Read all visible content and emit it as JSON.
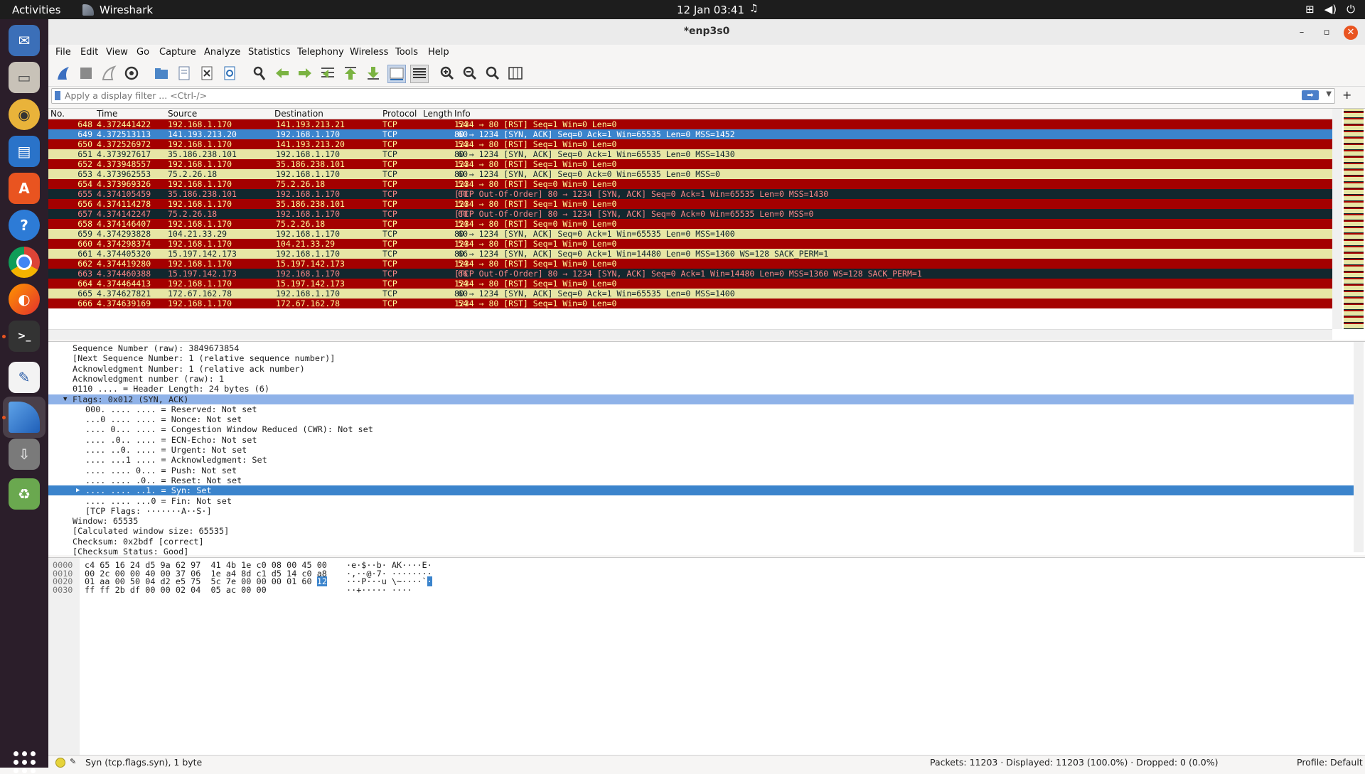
{
  "topbar": {
    "activities": "Activities",
    "app": "Wireshark",
    "clock": "12 Jan  03:41"
  },
  "window": {
    "title": "*enp3s0"
  },
  "menu": [
    "File",
    "Edit",
    "View",
    "Go",
    "Capture",
    "Analyze",
    "Statistics",
    "Telephony",
    "Wireless",
    "Tools",
    "Help"
  ],
  "filter": {
    "placeholder": "Apply a display filter ... <Ctrl-/>"
  },
  "columns": {
    "no": "No.",
    "time": "Time",
    "source": "Source",
    "destination": "Destination",
    "protocol": "Protocol",
    "length": "Length",
    "info": "Info"
  },
  "packets": [
    {
      "no": "648",
      "time": "4.372441422",
      "src": "192.168.1.170",
      "dst": "141.193.213.21",
      "proto": "TCP",
      "len": "54",
      "info": "1234 → 80 [RST] Seq=1 Win=0 Len=0",
      "style": "rst"
    },
    {
      "no": "649",
      "time": "4.372513113",
      "src": "141.193.213.20",
      "dst": "192.168.1.170",
      "proto": "TCP",
      "len": "60",
      "info": "80 → 1234 [SYN, ACK] Seq=0 Ack=1 Win=65535 Len=0 MSS=1452",
      "style": "selrow"
    },
    {
      "no": "650",
      "time": "4.372526972",
      "src": "192.168.1.170",
      "dst": "141.193.213.20",
      "proto": "TCP",
      "len": "54",
      "info": "1234 → 80 [RST] Seq=1 Win=0 Len=0",
      "style": "rst"
    },
    {
      "no": "651",
      "time": "4.373927617",
      "src": "35.186.238.101",
      "dst": "192.168.1.170",
      "proto": "TCP",
      "len": "60",
      "info": "80 → 1234 [SYN, ACK] Seq=0 Ack=1 Win=65535 Len=0 MSS=1430",
      "style": "synack"
    },
    {
      "no": "652",
      "time": "4.373948557",
      "src": "192.168.1.170",
      "dst": "35.186.238.101",
      "proto": "TCP",
      "len": "54",
      "info": "1234 → 80 [RST] Seq=1 Win=0 Len=0",
      "style": "rst"
    },
    {
      "no": "653",
      "time": "4.373962553",
      "src": "75.2.26.18",
      "dst": "192.168.1.170",
      "proto": "TCP",
      "len": "60",
      "info": "80 → 1234 [SYN, ACK] Seq=0 Ack=0 Win=65535 Len=0 MSS=0",
      "style": "synack"
    },
    {
      "no": "654",
      "time": "4.373969326",
      "src": "192.168.1.170",
      "dst": "75.2.26.18",
      "proto": "TCP",
      "len": "54",
      "info": "1234 → 80 [RST] Seq=0 Win=0 Len=0",
      "style": "rst"
    },
    {
      "no": "655",
      "time": "4.374105459",
      "src": "35.186.238.101",
      "dst": "192.168.1.170",
      "proto": "TCP",
      "len": "60",
      "info": "[TCP Out-Of-Order] 80 → 1234 [SYN, ACK] Seq=0 Ack=1 Win=65535 Len=0 MSS=1430",
      "style": "ooo"
    },
    {
      "no": "656",
      "time": "4.374114278",
      "src": "192.168.1.170",
      "dst": "35.186.238.101",
      "proto": "TCP",
      "len": "54",
      "info": "1234 → 80 [RST] Seq=1 Win=0 Len=0",
      "style": "rst"
    },
    {
      "no": "657",
      "time": "4.374142247",
      "src": "75.2.26.18",
      "dst": "192.168.1.170",
      "proto": "TCP",
      "len": "60",
      "info": "[TCP Out-Of-Order] 80 → 1234 [SYN, ACK] Seq=0 Ack=0 Win=65535 Len=0 MSS=0",
      "style": "ooo"
    },
    {
      "no": "658",
      "time": "4.374146407",
      "src": "192.168.1.170",
      "dst": "75.2.26.18",
      "proto": "TCP",
      "len": "54",
      "info": "1234 → 80 [RST] Seq=0 Win=0 Len=0",
      "style": "rst"
    },
    {
      "no": "659",
      "time": "4.374293828",
      "src": "104.21.33.29",
      "dst": "192.168.1.170",
      "proto": "TCP",
      "len": "60",
      "info": "80 → 1234 [SYN, ACK] Seq=0 Ack=1 Win=65535 Len=0 MSS=1400",
      "style": "synack"
    },
    {
      "no": "660",
      "time": "4.374298374",
      "src": "192.168.1.170",
      "dst": "104.21.33.29",
      "proto": "TCP",
      "len": "54",
      "info": "1234 → 80 [RST] Seq=1 Win=0 Len=0",
      "style": "rst"
    },
    {
      "no": "661",
      "time": "4.374405320",
      "src": "15.197.142.173",
      "dst": "192.168.1.170",
      "proto": "TCP",
      "len": "66",
      "info": "80 → 1234 [SYN, ACK] Seq=0 Ack=1 Win=14480 Len=0 MSS=1360 WS=128 SACK_PERM=1",
      "style": "synack"
    },
    {
      "no": "662",
      "time": "4.374419280",
      "src": "192.168.1.170",
      "dst": "15.197.142.173",
      "proto": "TCP",
      "len": "54",
      "info": "1234 → 80 [RST] Seq=1 Win=0 Len=0",
      "style": "rst"
    },
    {
      "no": "663",
      "time": "4.374460388",
      "src": "15.197.142.173",
      "dst": "192.168.1.170",
      "proto": "TCP",
      "len": "66",
      "info": "[TCP Out-Of-Order] 80 → 1234 [SYN, ACK] Seq=0 Ack=1 Win=14480 Len=0 MSS=1360 WS=128 SACK_PERM=1",
      "style": "ooo"
    },
    {
      "no": "664",
      "time": "4.374464413",
      "src": "192.168.1.170",
      "dst": "15.197.142.173",
      "proto": "TCP",
      "len": "54",
      "info": "1234 → 80 [RST] Seq=1 Win=0 Len=0",
      "style": "rst"
    },
    {
      "no": "665",
      "time": "4.374627821",
      "src": "172.67.162.78",
      "dst": "192.168.1.170",
      "proto": "TCP",
      "len": "60",
      "info": "80 → 1234 [SYN, ACK] Seq=0 Ack=1 Win=65535 Len=0 MSS=1400",
      "style": "synack"
    },
    {
      "no": "666",
      "time": "4.374639169",
      "src": "192.168.1.170",
      "dst": "172.67.162.78",
      "proto": "TCP",
      "len": "54",
      "info": "1234 → 80 [RST] Seq=1 Win=0 Len=0",
      "style": "rst"
    }
  ],
  "details": [
    {
      "text": "Sequence Number (raw): 3849673854",
      "indent": 1,
      "style": ""
    },
    {
      "text": "[Next Sequence Number: 1    (relative sequence number)]",
      "indent": 1,
      "style": ""
    },
    {
      "text": "Acknowledgment Number: 1    (relative ack number)",
      "indent": 1,
      "style": ""
    },
    {
      "text": "Acknowledgment number (raw): 1",
      "indent": 1,
      "style": ""
    },
    {
      "text": "0110 .... = Header Length: 24 bytes (6)",
      "indent": 1,
      "style": ""
    },
    {
      "text": "Flags: 0x012 (SYN, ACK)",
      "indent": 1,
      "style": "d-hl",
      "twisty": "open"
    },
    {
      "text": "000. .... .... = Reserved: Not set",
      "indent": 2,
      "style": ""
    },
    {
      "text": "...0 .... .... = Nonce: Not set",
      "indent": 2,
      "style": ""
    },
    {
      "text": ".... 0... .... = Congestion Window Reduced (CWR): Not set",
      "indent": 2,
      "style": ""
    },
    {
      "text": ".... .0.. .... = ECN-Echo: Not set",
      "indent": 2,
      "style": ""
    },
    {
      "text": ".... ..0. .... = Urgent: Not set",
      "indent": 2,
      "style": ""
    },
    {
      "text": ".... ...1 .... = Acknowledgment: Set",
      "indent": 2,
      "style": ""
    },
    {
      "text": ".... .... 0... = Push: Not set",
      "indent": 2,
      "style": ""
    },
    {
      "text": ".... .... .0.. = Reset: Not set",
      "indent": 2,
      "style": ""
    },
    {
      "text": ".... .... ..1. = Syn: Set",
      "indent": 2,
      "style": "d-sel",
      "twisty": "closed"
    },
    {
      "text": ".... .... ...0 = Fin: Not set",
      "indent": 2,
      "style": ""
    },
    {
      "text": "[TCP Flags: ·······A··S·]",
      "indent": 2,
      "style": ""
    },
    {
      "text": "Window: 65535",
      "indent": 1,
      "style": ""
    },
    {
      "text": "[Calculated window size: 65535]",
      "indent": 1,
      "style": ""
    },
    {
      "text": "Checksum: 0x2bdf [correct]",
      "indent": 1,
      "style": ""
    },
    {
      "text": "[Checksum Status: Good]",
      "indent": 1,
      "style": ""
    }
  ],
  "hex": [
    {
      "offset": "0000",
      "bytes": "c4 65 16 24 d5 9a 62 97  41 4b 1e c0 08 00 45 00",
      "sel": "",
      "ascii": "·e·$··b· AK····E·"
    },
    {
      "offset": "0010",
      "bytes": "00 2c 00 00 40 00 37 06  1e a4 8d c1 d5 14 c0 a8",
      "sel": "",
      "ascii": "·,··@·7· ········"
    },
    {
      "offset": "0020",
      "bytes": "01 aa 00 50 04 d2 e5 75  5c 7e 00 00 00 01 60 ",
      "sel": "12",
      "ascii": "···P···u \\~····`",
      "asel": "·"
    },
    {
      "offset": "0030",
      "bytes": "ff ff 2b df 00 00 02 04  05 ac 00 00",
      "sel": "",
      "ascii": "··+····· ····"
    }
  ],
  "status": {
    "field": "Syn (tcp.flags.syn), 1 byte",
    "packets": "Packets: 11203 · Displayed: 11203 (100.0%) · Dropped: 0 (0.0%)",
    "profile": "Profile: Default"
  },
  "colors": {
    "rst_bg": "#a40000",
    "rst_fg": "#fffc9c",
    "synack_bg": "#e7e6a5",
    "ooo_bg": "#12272e",
    "ooo_fg": "#f78787",
    "selection": "#3b84cc"
  }
}
